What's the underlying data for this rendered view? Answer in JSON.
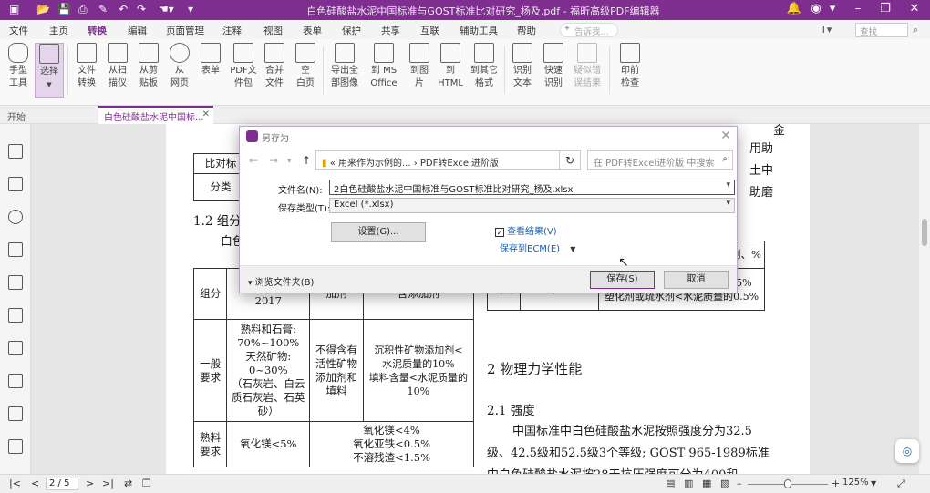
{
  "window": {
    "title": "白色硅酸盐水泥中国标准与GOST标准比对研究_杨及.pdf - 福昕高级PDF编辑器",
    "accent": "#7e2e8f"
  },
  "menu": {
    "items": [
      "文件",
      "主页",
      "转换",
      "编辑",
      "页面管理",
      "注释",
      "视图",
      "表单",
      "保护",
      "共享",
      "互联",
      "辅助工具",
      "帮助"
    ],
    "active": "转换",
    "tell_me": "告诉我...",
    "search": "查找"
  },
  "ribbon": {
    "buttons": [
      {
        "label": "手型\n工具"
      },
      {
        "label": "选择"
      },
      {
        "label": "文件\n转换"
      },
      {
        "label": "从扫\n描仪"
      },
      {
        "label": "从剪\n贴板"
      },
      {
        "label": "从\n网页"
      },
      {
        "label": "表单"
      },
      {
        "label": "PDF文\n件包"
      },
      {
        "label": "合并\n文件"
      },
      {
        "label": "空\n白页"
      },
      {
        "label": "导出全\n部图像"
      },
      {
        "label": "到 MS\nOffice"
      },
      {
        "label": "到图\n片"
      },
      {
        "label": "到\nHTML"
      },
      {
        "label": "到其它\n格式"
      },
      {
        "label": "识别\n文本"
      },
      {
        "label": "快速\n识别"
      },
      {
        "label": "疑似错\n误结果"
      },
      {
        "label": "印前\n检查"
      }
    ]
  },
  "tabs": {
    "home": "开始",
    "doc": "白色硅酸盐水泥中国标..."
  },
  "document": {
    "frag_top_right": [
      "金",
      "用助",
      "土中",
      "助磨"
    ],
    "table1": {
      "header": "比对标",
      "row": "分类"
    },
    "section12": "1.2  组分",
    "sub12": "白色",
    "table2": {
      "col_group": "组分",
      "col_c": "C",
      "col_year": "2017",
      "col_with": "含添加剂",
      "col_add": "加剂",
      "general": "一般\n要求",
      "general_cells": [
        "熟料和石膏:\n70%~100%\n天然矿物:\n0~30%\n（石灰岩、白云\n质石灰岩、石英\n砂）",
        "不得含有\n活性矿物\n添加剂和\n填料",
        "沉积性矿物添加剂<\n水泥质量的10%\n填料含量<水泥质量的\n10%"
      ],
      "clinker": "熟料\n要求",
      "clinker_cells": [
        "氧化镁<5%",
        "氧化镁<4%\n氧化亚铁<0.5%\n不溶残渣<1.5%"
      ]
    },
    "table3": {
      "row_a": "加剂、%",
      "row_b1": "助剂",
      "row_b2": "量的0.5%",
      "row_b3": "有机添加剂<水泥质量的0.15%\n塑化剂或疏水剂<水泥质量的0.5%"
    },
    "section2": "2   物理力学性能",
    "section21": "2.1  强度",
    "para": [
      "中国标准中白色硅酸盐水泥按照强度分为32.5",
      "级、42.5级和52.5级3个等级; GOST 965-1989标准",
      "中白色硅酸盐水泥按28天抗压强度可分为400和"
    ]
  },
  "dialog": {
    "title": "另存为",
    "path": "«  用来作为示例的...  ›  PDF转Excel进阶版",
    "search_placeholder": "在 PDF转Excel进阶版 中搜索",
    "filename_label": "文件名(N):",
    "filename_value": "2白色硅酸盐水泥中国标准与GOST标准比对研究_杨及.xlsx",
    "type_label": "保存类型(T):",
    "type_value": "Excel (*.xlsx)",
    "settings": "设置(G)...",
    "view_result": "查看结果(V)",
    "view_result_checked": true,
    "save_ecm": "保存到ECM(E)",
    "browse": "浏览文件夹(B)",
    "save": "保存(S)",
    "cancel": "取消"
  },
  "status": {
    "page": "2 / 5",
    "zoom": "125%",
    "zoom_level": 0.5
  }
}
